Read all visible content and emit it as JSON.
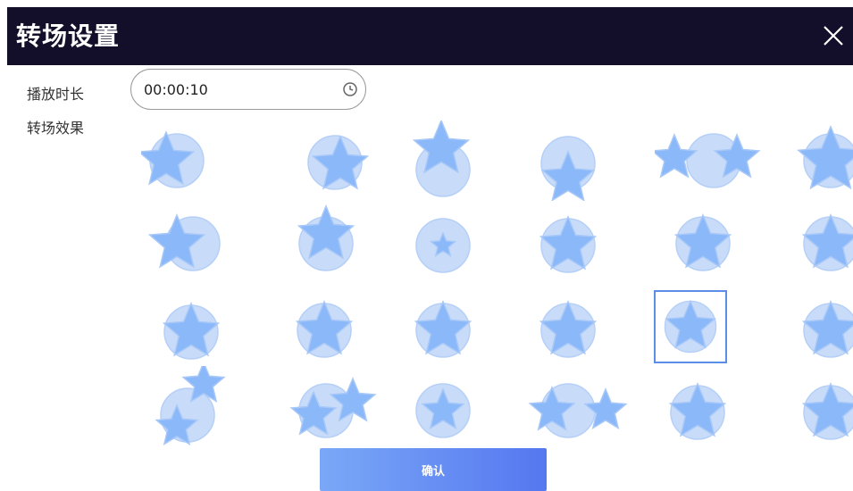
{
  "dialog": {
    "title": "转场设置",
    "close_icon": "close-icon"
  },
  "duration": {
    "label": "播放时长",
    "value": "00:00:10",
    "icon": "clock-icon"
  },
  "effects": {
    "label": "转场效果",
    "selected_index": 16,
    "colors": {
      "circle": "#c8dcfa",
      "star": "#8ab8f8",
      "star_stroke": "#a8c8f8",
      "selection": "#5b8ee6"
    }
  },
  "footer": {
    "confirm_label": "确认",
    "confirm_gradient": [
      "#7aa8f7",
      "#5577f0"
    ]
  },
  "titlebar_color": "#130f2b"
}
